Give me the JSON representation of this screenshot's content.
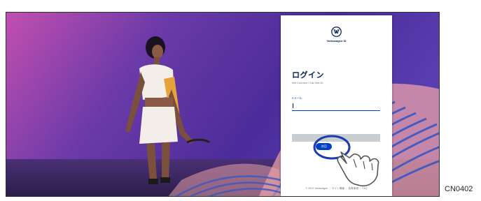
{
  "login": {
    "brand": "Volkswagen ID",
    "heading": "ログイン",
    "subheading": "We Connect / Car-Net ID",
    "email_label": "Eメール",
    "email_value": "",
    "next_label": "次回",
    "footer": "© 2021 Volkswagen ｜ サイト情報 ｜ 免責事項 ｜ FAQ"
  },
  "figure_code": "CN0402",
  "colors": {
    "brand_navy": "#001e50",
    "accent_blue": "#0040c5",
    "background_purple": "#6a3aa8"
  },
  "icons": {
    "logo": "vw-logo-icon",
    "pointer": "pointing-hand-icon"
  }
}
